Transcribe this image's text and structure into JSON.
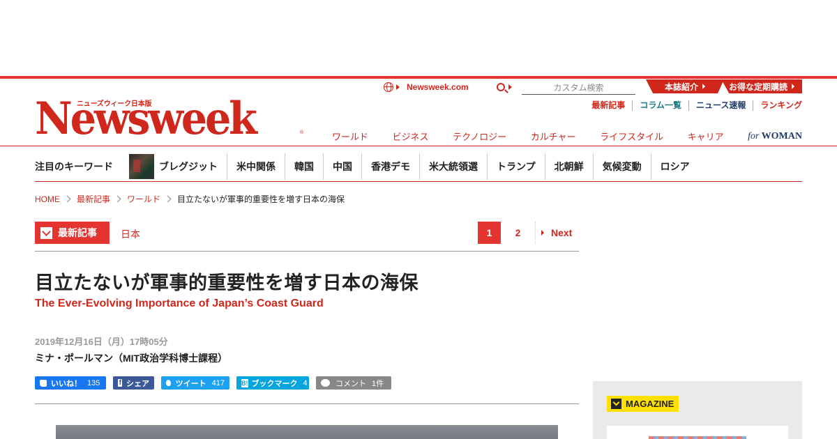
{
  "brand": {
    "logo_sub": "ニューズウィーク日本版",
    "logo": "Newsweek",
    "reg": "®"
  },
  "utility": {
    "site_link": "Newsweek.com",
    "search_placeholder": "カスタム検索",
    "promo_about": "本誌紹介",
    "promo_subscribe": "お得な定期購読"
  },
  "subnav": [
    "最新記事",
    "コラム一覧",
    "ニュース速報",
    "ランキング"
  ],
  "mainnav": [
    "ワールド",
    "ビジネス",
    "テクノロジー",
    "カルチャー",
    "ライフスタイル",
    "キャリア"
  ],
  "for_woman": {
    "for": "for",
    "woman": "WOMAN"
  },
  "keywords": {
    "title": "注目のキーワード",
    "items": [
      "ブレグジット",
      "米中関係",
      "韓国",
      "中国",
      "香港デモ",
      "米大統領選",
      "トランプ",
      "北朝鮮",
      "気候変動",
      "ロシア"
    ]
  },
  "breadcrumb": [
    "HOME",
    "最新記事",
    "ワールド",
    "目立たないが軍事的重要性を増す日本の海保"
  ],
  "category": {
    "label": "最新記事",
    "tag": "日本"
  },
  "pager": {
    "page1": "1",
    "page2": "2",
    "next": "Next"
  },
  "article": {
    "title": "目立たないが軍事的重要性を増す日本の海保",
    "title_en": "The Ever-Evolving Importance of Japan’s Coast Guard",
    "date": "2019年12月16日（月）17時05分",
    "author": "ミナ・ポールマン（MIT政治学科博士課程）"
  },
  "share": {
    "like": "いいね！",
    "like_count": "135",
    "fb_share": "シェア",
    "tweet": "ツイート",
    "tweet_count": "417",
    "hatena": "ブックマーク",
    "hatena_count": "4",
    "comment": "コメント",
    "comment_count": "1件"
  },
  "sidebar": {
    "magazine_label": "MAGAZINE"
  },
  "colors": {
    "brand_red": "#d0271d",
    "accent_red": "#e3342f",
    "facebook": "#1877f2",
    "twitter": "#1da1f2",
    "hatena": "#00a4de",
    "magazine_yellow": "#ffe100"
  }
}
